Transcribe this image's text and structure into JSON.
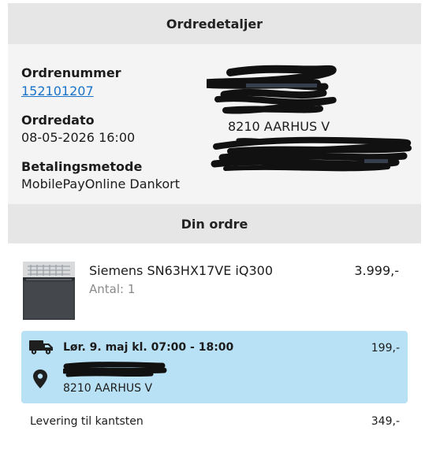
{
  "headers": {
    "order_details": "Ordredetaljer",
    "your_order": "Din ordre"
  },
  "order": {
    "number_label": "Ordrenummer",
    "number_value": "152101207",
    "date_label": "Ordredato",
    "date_value": "08-05-2026 16:00",
    "payment_label": "Betalingsmetode",
    "payment_value": "MobilePayOnline Dankort"
  },
  "billing_address": {
    "city_line": "8210 AARHUS V"
  },
  "product": {
    "name": "Siemens SN63HX17VE iQ300",
    "quantity": "Antal: 1",
    "price": "3.999,-"
  },
  "delivery": {
    "slot": "Lør. 9. maj kl. 07:00 - 18:00",
    "price": "199,-",
    "city_line": "8210 AARHUS V",
    "truck_icon": "truck-icon",
    "pin_icon": "location-pin-icon"
  },
  "curbside": {
    "label": "Levering til kantsten",
    "price": "349,-"
  }
}
